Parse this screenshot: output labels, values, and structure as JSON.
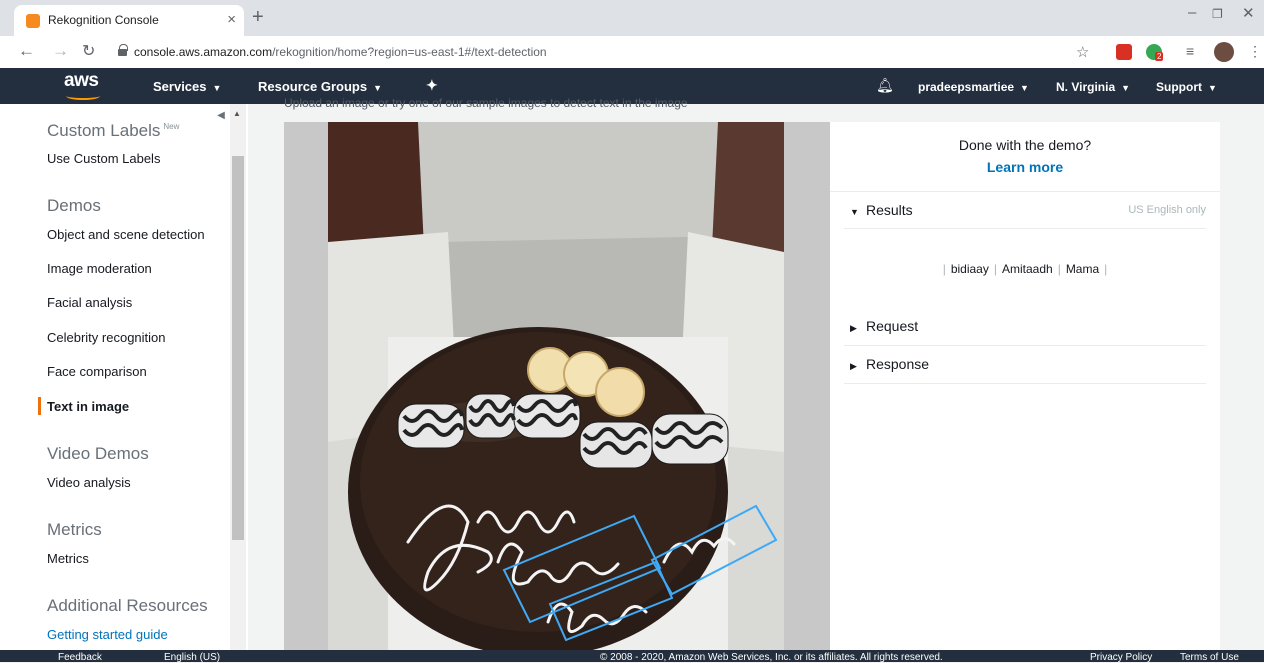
{
  "browser": {
    "tab_title": "Rekognition Console",
    "tab_close": "×",
    "new_tab": "+",
    "url_host": "console.aws.amazon.com",
    "url_path": "/rekognition/home?region=us-east-1#/text-detection",
    "minimize": "–",
    "restore": "❐",
    "close": "✕",
    "badge_count": "2"
  },
  "aws_nav": {
    "logo": "aws",
    "services": "Services",
    "resource_groups": "Resource Groups",
    "user": "pradeepsmartiee",
    "region": "N. Virginia",
    "support": "Support"
  },
  "sidebar": {
    "custom_labels_heading": "Custom Labels",
    "new_badge": "New",
    "use_custom_labels": "Use Custom Labels",
    "demos_heading": "Demos",
    "demos": [
      "Object and scene detection",
      "Image moderation",
      "Facial analysis",
      "Celebrity recognition",
      "Face comparison",
      "Text in image"
    ],
    "video_demos_heading": "Video Demos",
    "video_analysis": "Video analysis",
    "metrics_heading": "Metrics",
    "metrics": "Metrics",
    "additional_heading": "Additional Resources",
    "getting_started": "Getting started guide"
  },
  "main": {
    "truncated_text": "Upload an image or try one of our sample images to detect text in the image"
  },
  "results": {
    "done_text": "Done with the demo?",
    "learn_more": "Learn more",
    "results_label": "Results",
    "locale_note": "US English only",
    "words": [
      "bidiaay",
      "Amitaadh",
      "Mama"
    ],
    "request_label": "Request",
    "response_label": "Response"
  },
  "footer": {
    "feedback": "Feedback",
    "language": "English (US)",
    "copyright": "© 2008 - 2020, Amazon Web Services, Inc. or its affiliates. All rights reserved.",
    "privacy": "Privacy Policy",
    "terms": "Terms of Use"
  },
  "colors": {
    "aws_nav": "#232f3e",
    "aws_orange": "#ff9900",
    "link_blue": "#0073bb",
    "bounding_box": "#3fa9f5"
  }
}
